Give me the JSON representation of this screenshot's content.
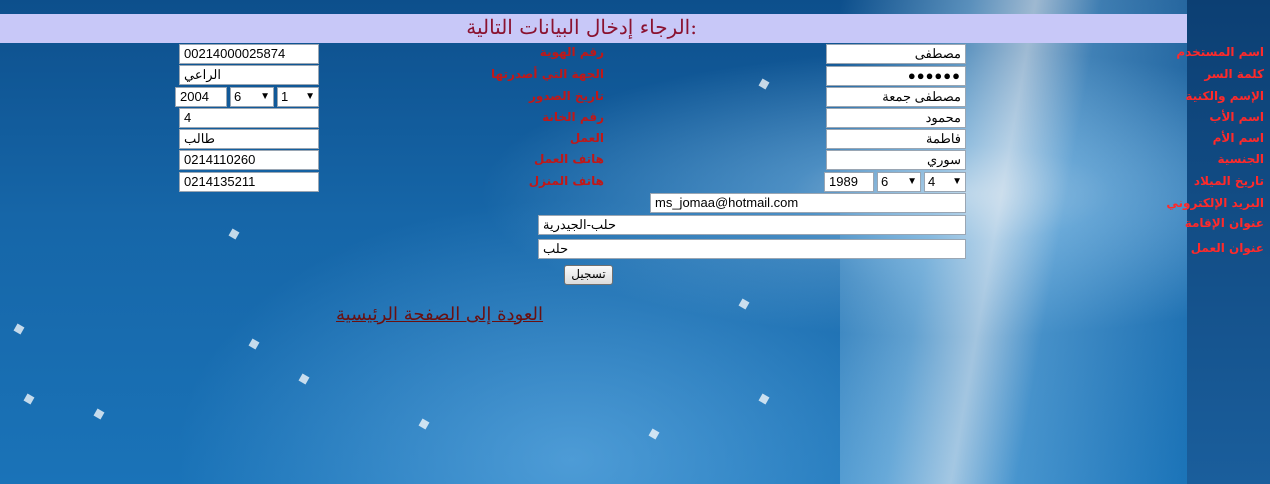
{
  "header": {
    "title": "الرجاء إدخال البيانات التالية:"
  },
  "labels_right": [
    "اسم المستخدم",
    "كلمة السر",
    "الإسم والكنية",
    "اسم الأب",
    "اسم الأم",
    "الجنسية",
    "تاريخ الميلاد",
    "البريد الإلكتروني",
    "عنوان الإقامة",
    "عنوان العمل"
  ],
  "labels_middle": [
    "رقم الهوية",
    "الجهة التي أصدرتها",
    "تاريخ الصدور",
    "رقم الخانة",
    "العمل",
    "هاتف العمل",
    "هاتف المنزل"
  ],
  "fields_right": {
    "username": "مصطفى",
    "password": "●●●●●●",
    "fullname": "مصطفى جمعة",
    "father_name": "محمود",
    "mother_name": "فاطمة",
    "nationality": "سوري",
    "birth_year": "1989",
    "birth_month": "6",
    "birth_day": "4",
    "email": "ms_jomaa@hotmail.com",
    "home_address": "حلب-الجيدرية",
    "work_address": "حلب"
  },
  "fields_middle": {
    "id_number": "00214000025874",
    "issuer": "الراعي",
    "issue_year": "2004",
    "issue_month": "6",
    "issue_day": "1",
    "registry_number": "4",
    "job": "طالب",
    "work_phone": "0214110260",
    "home_phone": "0214135211"
  },
  "buttons": {
    "submit": "تسجيل"
  },
  "links": {
    "back_home": "العودة إلى الصفحة الرئيسية"
  },
  "icons": {
    "dropdown": "chevron-down-icon"
  }
}
